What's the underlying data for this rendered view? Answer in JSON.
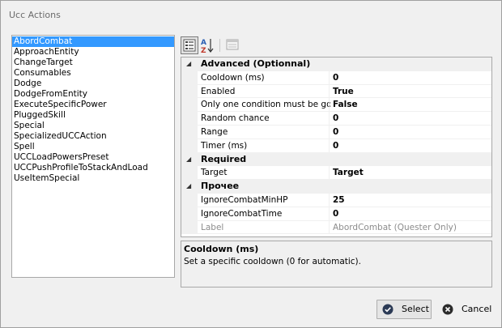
{
  "window": {
    "title": "Ucc Actions"
  },
  "actions": [
    "AbordCombat",
    "ApproachEntity",
    "ChangeTarget",
    "Consumables",
    "Dodge",
    "DodgeFromEntity",
    "ExecuteSpecificPower",
    "PluggedSkill",
    "Special",
    "SpecializedUCCAction",
    "Spell",
    "UCCLoadPowersPreset",
    "UCCPushProfileToStackAndLoad",
    "UseItemSpecial"
  ],
  "selected_action": "AbordCombat",
  "toolbar": {
    "categorized_icon": "categorized-icon",
    "alphabetical_icon": "sort-az-icon",
    "property_pages_icon": "property-pages-icon"
  },
  "grid": {
    "categories": [
      {
        "label": "Advanced (Optionnal)",
        "props": [
          {
            "name": "Cooldown (ms)",
            "value": "0"
          },
          {
            "name": "Enabled",
            "value": "True"
          },
          {
            "name": "Only one condition must be good",
            "value": "False"
          },
          {
            "name": "Random chance",
            "value": "0"
          },
          {
            "name": "Range",
            "value": "0"
          },
          {
            "name": "Timer (ms)",
            "value": "0"
          }
        ]
      },
      {
        "label": "Required",
        "props": [
          {
            "name": "Target",
            "value": "Target"
          }
        ]
      },
      {
        "label": "Прочее",
        "props": [
          {
            "name": "IgnoreCombatMinHP",
            "value": "25"
          },
          {
            "name": "IgnoreCombatTime",
            "value": "0"
          },
          {
            "name": "Label",
            "value": "AbordCombat (Quester Only)",
            "readonly": true
          }
        ]
      }
    ]
  },
  "description": {
    "title": "Cooldown (ms)",
    "text": "Set a specific cooldown (0 for automatic)."
  },
  "buttons": {
    "select_label": "Select",
    "cancel_label": "Cancel"
  },
  "colors": {
    "selection": "#3399ff",
    "select_icon": "#2b3a55",
    "cancel_icon": "#2b2b2b"
  }
}
